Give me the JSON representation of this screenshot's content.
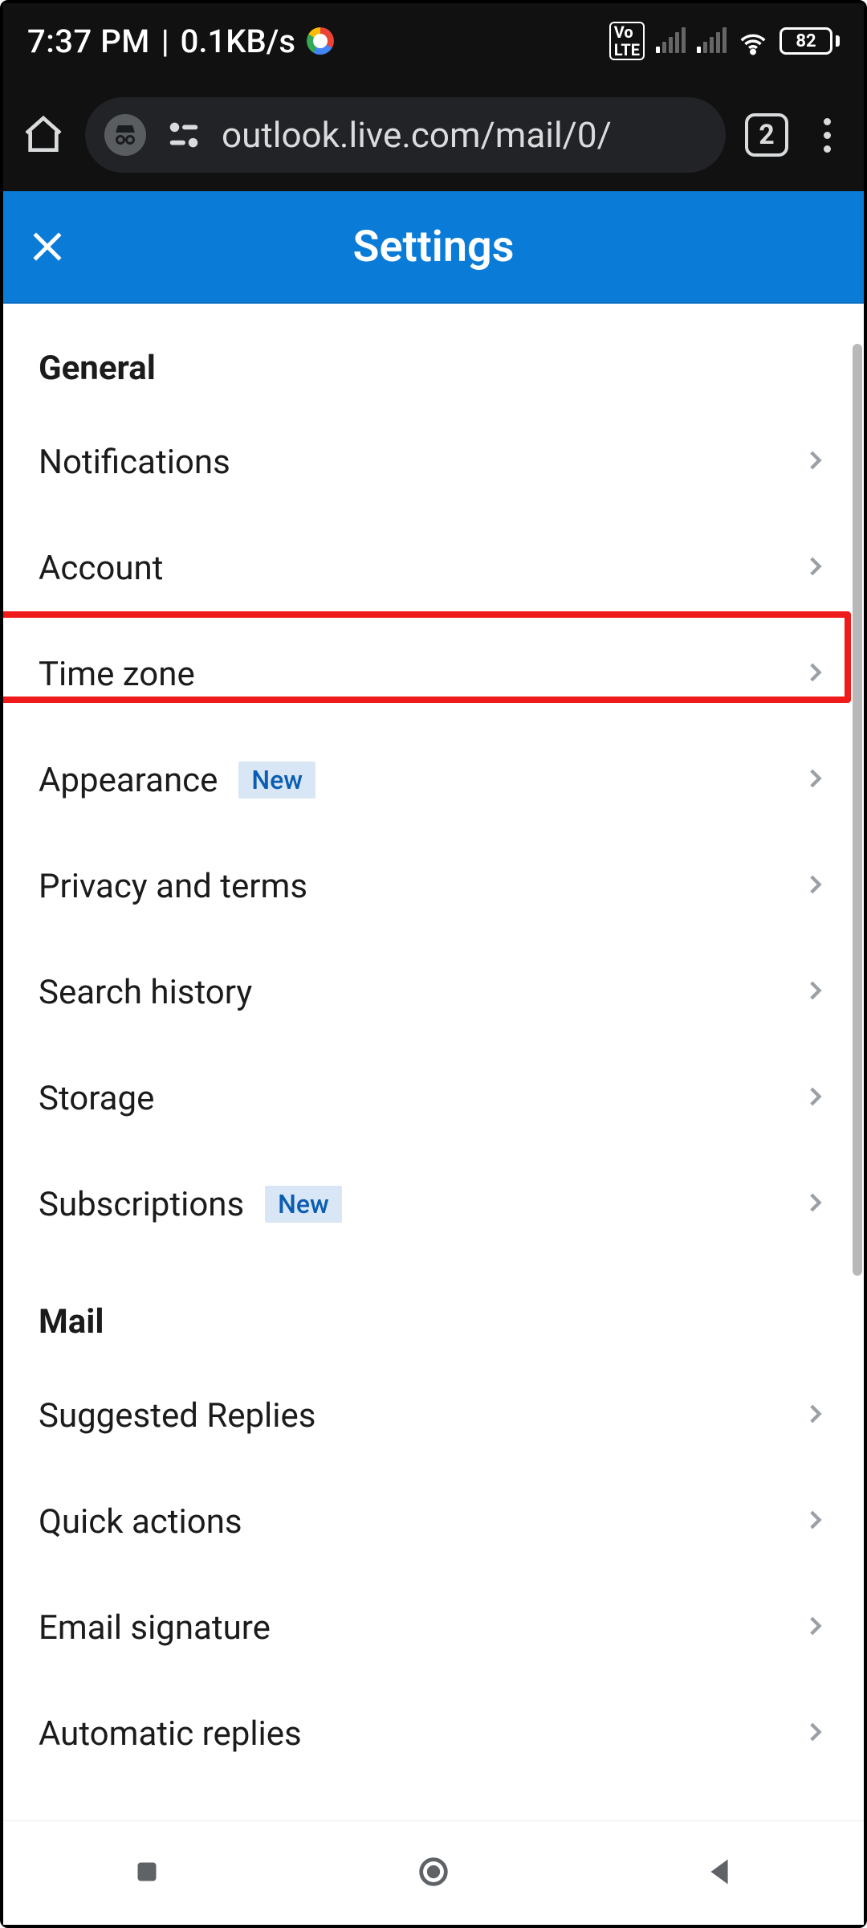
{
  "status": {
    "time": "7:37 PM",
    "speed": "0.1KB/s",
    "battery": "82"
  },
  "browser": {
    "url": "outlook.live.com/mail/0/",
    "tab_count": "2"
  },
  "header": {
    "title": "Settings"
  },
  "sections": [
    {
      "title": "General",
      "items": [
        {
          "label": "Notifications",
          "badge": null
        },
        {
          "label": "Account",
          "badge": null
        },
        {
          "label": "Time zone",
          "badge": null
        },
        {
          "label": "Appearance",
          "badge": "New"
        },
        {
          "label": "Privacy and terms",
          "badge": null
        },
        {
          "label": "Search history",
          "badge": null
        },
        {
          "label": "Storage",
          "badge": null
        },
        {
          "label": "Subscriptions",
          "badge": "New"
        }
      ]
    },
    {
      "title": "Mail",
      "items": [
        {
          "label": "Suggested Replies",
          "badge": null
        },
        {
          "label": "Quick actions",
          "badge": null
        },
        {
          "label": "Email signature",
          "badge": null
        },
        {
          "label": "Automatic replies",
          "badge": null
        }
      ]
    }
  ],
  "highlight": {
    "section": 0,
    "item": 2
  }
}
